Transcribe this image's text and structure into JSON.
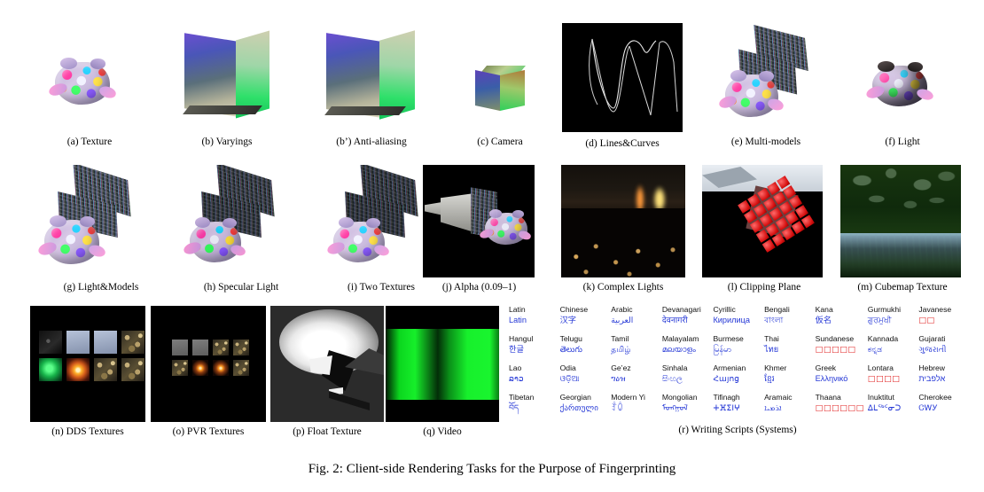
{
  "figure": {
    "caption": "Fig. 2: Client-side Rendering Tasks for the Purpose of Fingerprinting"
  },
  "panels": [
    {
      "id": "a",
      "label": "(a) Texture"
    },
    {
      "id": "b",
      "label": "(b) Varyings"
    },
    {
      "id": "b2",
      "label": "(b’) Anti-aliasing"
    },
    {
      "id": "c",
      "label": "(c) Camera"
    },
    {
      "id": "d",
      "label": "(d) Lines&Curves"
    },
    {
      "id": "e",
      "label": "(e) Multi-models"
    },
    {
      "id": "f",
      "label": "(f) Light"
    },
    {
      "id": "g",
      "label": "(g) Light&Models"
    },
    {
      "id": "h",
      "label": "(h) Specular Light"
    },
    {
      "id": "i",
      "label": "(i) Two Textures"
    },
    {
      "id": "j",
      "label": "(j) Alpha (0.09–1)"
    },
    {
      "id": "k",
      "label": "(k) Complex Lights"
    },
    {
      "id": "l",
      "label": "(l) Clipping Plane"
    },
    {
      "id": "m",
      "label": "(m) Cubemap Texture"
    },
    {
      "id": "n",
      "label": "(n) DDS Textures"
    },
    {
      "id": "o",
      "label": "(o) PVR Textures"
    },
    {
      "id": "p",
      "label": "(p) Float Texture"
    },
    {
      "id": "q",
      "label": "(q) Video"
    },
    {
      "id": "r",
      "label": "(r) Writing Scripts (Systems)"
    }
  ],
  "scripts": {
    "rows": [
      [
        {
          "name": "Latin",
          "sample": "Latin",
          "tofu": false
        },
        {
          "name": "Chinese",
          "sample": "汉字",
          "tofu": false
        },
        {
          "name": "Arabic",
          "sample": "العربية",
          "tofu": false
        },
        {
          "name": "Devanagari",
          "sample": "देवनागरी",
          "tofu": false
        },
        {
          "name": "Cyrillic",
          "sample": "Кирилица",
          "tofu": false
        },
        {
          "name": "Bengali",
          "sample": "বাংলা",
          "tofu": false
        },
        {
          "name": "Kana",
          "sample": "仮名",
          "tofu": false
        },
        {
          "name": "Gurmukhi",
          "sample": "ਗੁਰਮੁਖੀ",
          "tofu": false
        },
        {
          "name": "Javanese",
          "sample": "□□",
          "tofu": true
        }
      ],
      [
        {
          "name": "Hangul",
          "sample": "한글",
          "tofu": false
        },
        {
          "name": "Telugu",
          "sample": "తెలుగు",
          "tofu": false
        },
        {
          "name": "Tamil",
          "sample": "தமிழ்",
          "tofu": false
        },
        {
          "name": "Malayalam",
          "sample": "മലയാളം",
          "tofu": false
        },
        {
          "name": "Burmese",
          "sample": "မြန်မာ",
          "tofu": false
        },
        {
          "name": "Thai",
          "sample": "ไทย",
          "tofu": false
        },
        {
          "name": "Sundanese",
          "sample": "□□□□□",
          "tofu": true
        },
        {
          "name": "Kannada",
          "sample": "ಕನ್ನಡ",
          "tofu": false
        },
        {
          "name": "Gujarati",
          "sample": "ગુજરાતી",
          "tofu": false
        }
      ],
      [
        {
          "name": "Lao",
          "sample": "ລາວ",
          "tofu": false
        },
        {
          "name": "Odia",
          "sample": "ଓଡ଼ିଆ",
          "tofu": false
        },
        {
          "name": "Ge’ez",
          "sample": "ግዕዝ",
          "tofu": false
        },
        {
          "name": "Sinhala",
          "sample": "සිංහල",
          "tofu": false
        },
        {
          "name": "Armenian",
          "sample": "Հայոց",
          "tofu": false
        },
        {
          "name": "Khmer",
          "sample": "ខ្មែរ",
          "tofu": false
        },
        {
          "name": "Greek",
          "sample": "Ελληνικό",
          "tofu": false
        },
        {
          "name": "Lontara",
          "sample": "□□□□",
          "tofu": true
        },
        {
          "name": "Hebrew",
          "sample": "אלפבית",
          "tofu": false
        }
      ],
      [
        {
          "name": "Tibetan",
          "sample": "བོད",
          "tofu": false
        },
        {
          "name": "Georgian",
          "sample": "ქართული",
          "tofu": false
        },
        {
          "name": "Modern Yi",
          "sample": "ꆇꐍ",
          "tofu": false
        },
        {
          "name": "Mongolian",
          "sample": "ᠮᠣᠩᠭᠣᠯ",
          "tofu": false
        },
        {
          "name": "Tifinagh",
          "sample": "ⵜⴼⵉⵏⵖ",
          "tofu": false
        },
        {
          "name": "Aramaic",
          "sample": "ܐܪܡܝܐ",
          "tofu": false
        },
        {
          "name": "Thaana",
          "sample": "□□□□□□",
          "tofu": true
        },
        {
          "name": "Inuktitut",
          "sample": "ᐃᒪᖅᑦᓂᑐ",
          "tofu": false
        },
        {
          "name": "Cherokee",
          "sample": "ᏣᎳᎩ",
          "tofu": false
        }
      ]
    ]
  },
  "colors": {
    "sample_text": "#2437d6",
    "tofu": "#e02020",
    "panel_black": "#000000",
    "page_background": "#ffffff"
  }
}
